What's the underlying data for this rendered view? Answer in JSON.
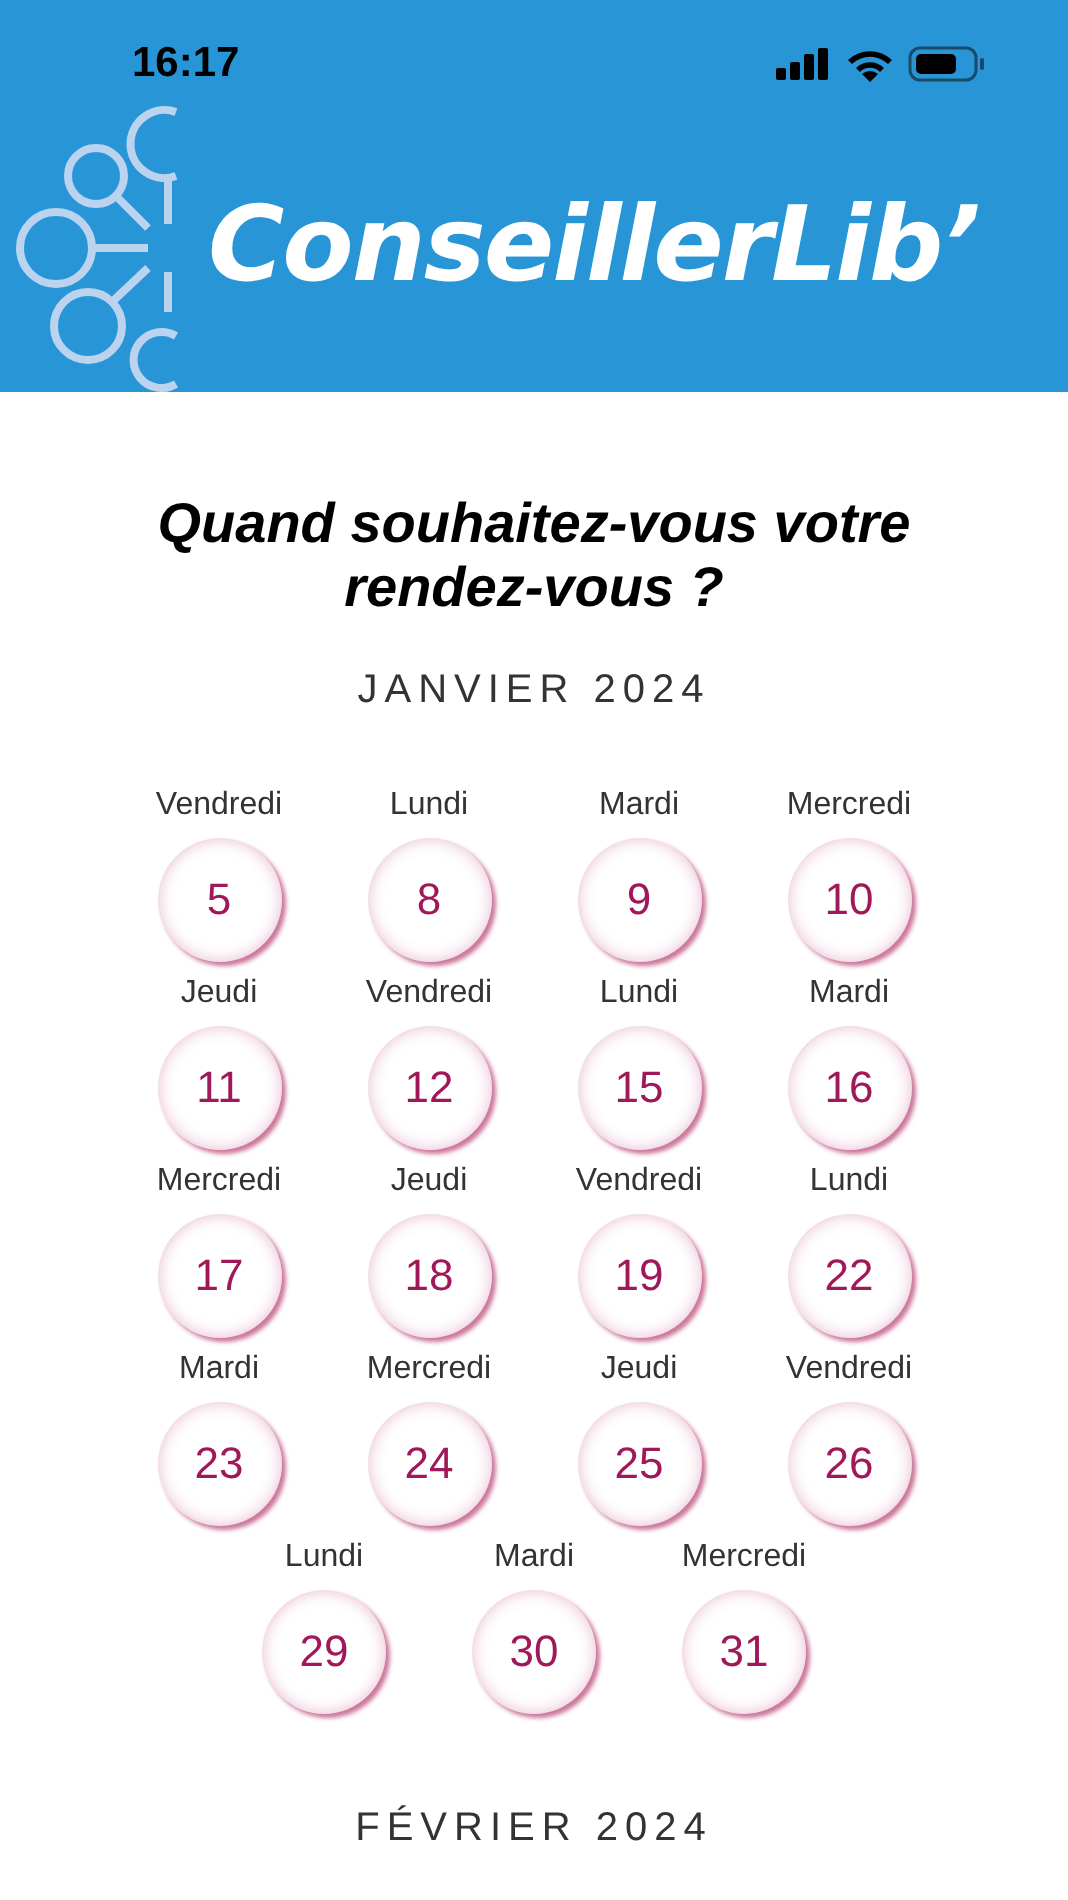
{
  "status_bar": {
    "time": "16:17"
  },
  "header": {
    "brand": "ConseillerLib’"
  },
  "title": "Quand souhaitez-vous votre rendez-vous ?",
  "months": [
    {
      "name": "JANVIER 2024",
      "days": [
        {
          "weekday": "Vendredi",
          "day": "5"
        },
        {
          "weekday": "Lundi",
          "day": "8"
        },
        {
          "weekday": "Mardi",
          "day": "9"
        },
        {
          "weekday": "Mercredi",
          "day": "10"
        },
        {
          "weekday": "Jeudi",
          "day": "11"
        },
        {
          "weekday": "Vendredi",
          "day": "12"
        },
        {
          "weekday": "Lundi",
          "day": "15"
        },
        {
          "weekday": "Mardi",
          "day": "16"
        },
        {
          "weekday": "Mercredi",
          "day": "17"
        },
        {
          "weekday": "Jeudi",
          "day": "18"
        },
        {
          "weekday": "Vendredi",
          "day": "19"
        },
        {
          "weekday": "Lundi",
          "day": "22"
        },
        {
          "weekday": "Mardi",
          "day": "23"
        },
        {
          "weekday": "Mercredi",
          "day": "24"
        },
        {
          "weekday": "Jeudi",
          "day": "25"
        },
        {
          "weekday": "Vendredi",
          "day": "26"
        },
        {
          "weekday": "Lundi",
          "day": "29"
        },
        {
          "weekday": "Mardi",
          "day": "30"
        },
        {
          "weekday": "Mercredi",
          "day": "31"
        }
      ]
    },
    {
      "name": "FÉVRIER 2024"
    }
  ]
}
